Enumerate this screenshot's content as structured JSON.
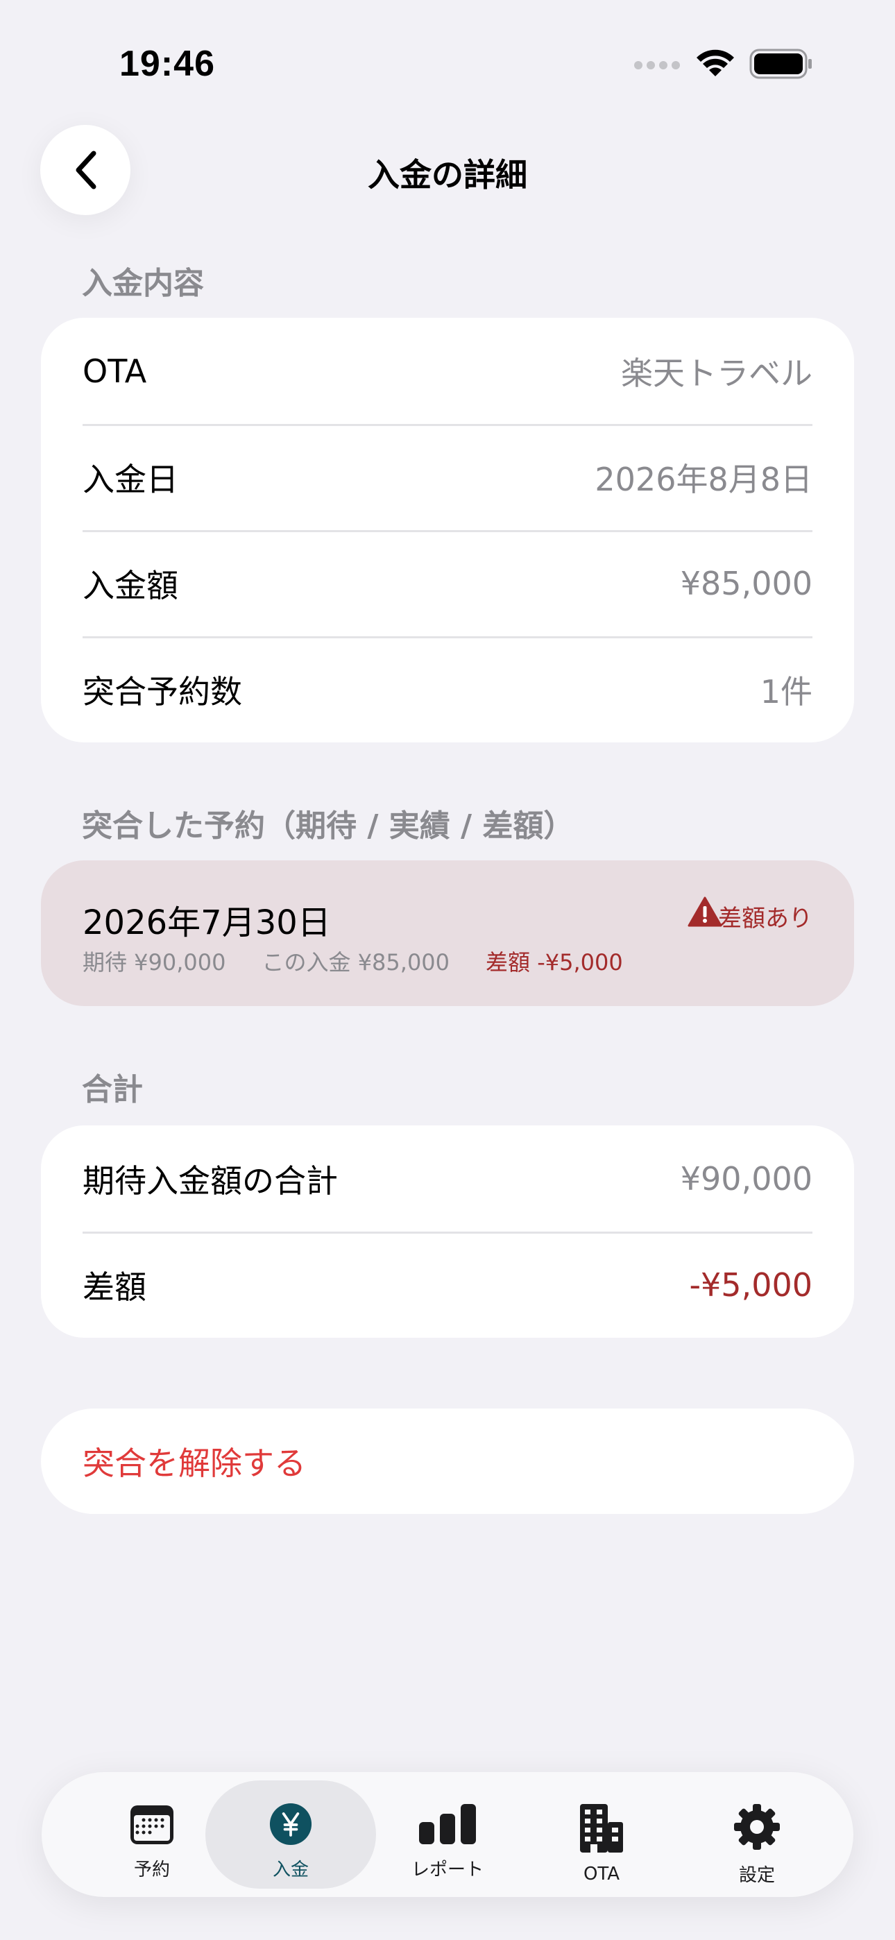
{
  "status_bar": {
    "time": "19:46"
  },
  "nav": {
    "title": "入金の詳細"
  },
  "payment_section": {
    "header": "入金内容",
    "rows": [
      {
        "label": "OTA",
        "value": "楽天トラベル"
      },
      {
        "label": "入金日",
        "value": "2026年8月8日"
      },
      {
        "label": "入金額",
        "value": "¥85,000"
      },
      {
        "label": "突合予約数",
        "value": "1件"
      }
    ]
  },
  "reconciled_section": {
    "header": "突合した予約（期待 / 実績 / 差額）",
    "items": [
      {
        "date": "2026年7月30日",
        "expected": "期待 ¥90,000",
        "this_payment": "この入金 ¥85,000",
        "difference": "差額 -¥5,000",
        "status": "差額あり",
        "icon": "warning-triangle-icon"
      }
    ]
  },
  "total_section": {
    "header": "合計",
    "rows": [
      {
        "label": "期待入金額の合計",
        "value": "¥90,000"
      },
      {
        "label": "差額",
        "value": "-¥5,000"
      }
    ]
  },
  "actions": {
    "unmatch_label": "突合を解除する"
  },
  "tabbar": {
    "tabs": [
      {
        "label": "予約",
        "icon": "calendar-icon"
      },
      {
        "label": "入金",
        "icon": "yen-icon",
        "active": true
      },
      {
        "label": "レポート",
        "icon": "bar-chart-icon"
      },
      {
        "label": "OTA",
        "icon": "building-icon"
      },
      {
        "label": "設定",
        "icon": "gear-icon"
      }
    ]
  },
  "colors": {
    "background": "#f2f1f6",
    "negative": "#a32b2b",
    "destructive": "#e03a3a",
    "accent": "#0f5160",
    "warning_card": "#e8dde1"
  }
}
